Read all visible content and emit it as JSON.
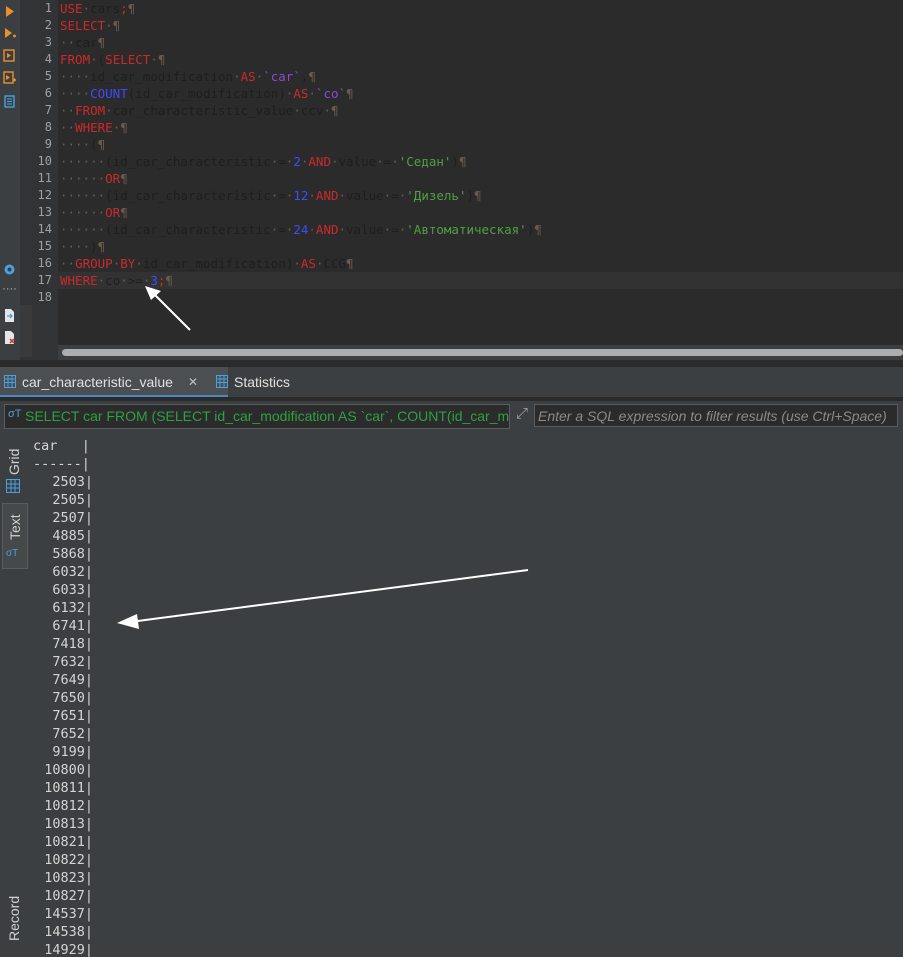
{
  "editor": {
    "line_numbers": [
      "1",
      "2",
      "3",
      "4",
      "5",
      "6",
      "7",
      "8",
      "9",
      "10",
      "11",
      "12",
      "13",
      "14",
      "15",
      "16",
      "17",
      "18"
    ],
    "lines": [
      [
        {
          "t": "USE",
          "c": "kw"
        },
        {
          "t": "·",
          "c": "ws"
        },
        {
          "t": "cars",
          "c": "id"
        },
        {
          "t": ";",
          "c": "kw"
        },
        {
          "t": "¶",
          "c": "pil"
        }
      ],
      [
        {
          "t": "SELECT",
          "c": "kw"
        },
        {
          "t": "·¶",
          "c": "ws"
        }
      ],
      [
        {
          "t": "··",
          "c": "ws"
        },
        {
          "t": "car",
          "c": "id"
        },
        {
          "t": "¶",
          "c": "pil"
        }
      ],
      [
        {
          "t": "FROM",
          "c": "kw"
        },
        {
          "t": "·",
          "c": "ws"
        },
        {
          "t": "(",
          "c": "id"
        },
        {
          "t": "SELECT",
          "c": "kw"
        },
        {
          "t": "·¶",
          "c": "ws"
        }
      ],
      [
        {
          "t": "····",
          "c": "ws"
        },
        {
          "t": "id_car_modification",
          "c": "id"
        },
        {
          "t": "·",
          "c": "ws"
        },
        {
          "t": "AS",
          "c": "kw"
        },
        {
          "t": "·",
          "c": "ws"
        },
        {
          "t": "`car`",
          "c": "bq"
        },
        {
          "t": ",",
          "c": "id"
        },
        {
          "t": "¶",
          "c": "pil"
        }
      ],
      [
        {
          "t": "····",
          "c": "ws"
        },
        {
          "t": "COUNT",
          "c": "fn"
        },
        {
          "t": "(id_car_modification)",
          "c": "id"
        },
        {
          "t": "·",
          "c": "ws"
        },
        {
          "t": "AS",
          "c": "kw"
        },
        {
          "t": "·",
          "c": "ws"
        },
        {
          "t": "`co`",
          "c": "bq"
        },
        {
          "t": "¶",
          "c": "pil"
        }
      ],
      [
        {
          "t": "··",
          "c": "ws"
        },
        {
          "t": "FROM",
          "c": "kw"
        },
        {
          "t": "·",
          "c": "ws"
        },
        {
          "t": "car_characteristic_value",
          "c": "id"
        },
        {
          "t": "·",
          "c": "ws"
        },
        {
          "t": "ccv",
          "c": "id"
        },
        {
          "t": "·¶",
          "c": "ws"
        }
      ],
      [
        {
          "t": "··",
          "c": "ws"
        },
        {
          "t": "WHERE",
          "c": "kw"
        },
        {
          "t": "·¶",
          "c": "ws"
        }
      ],
      [
        {
          "t": "····",
          "c": "ws"
        },
        {
          "t": "(",
          "c": "id"
        },
        {
          "t": "¶",
          "c": "pil"
        }
      ],
      [
        {
          "t": "······",
          "c": "ws"
        },
        {
          "t": "(id_car_characteristic",
          "c": "id"
        },
        {
          "t": "·",
          "c": "ws"
        },
        {
          "t": "=",
          "c": "id"
        },
        {
          "t": "·",
          "c": "ws"
        },
        {
          "t": "2",
          "c": "num"
        },
        {
          "t": "·",
          "c": "ws"
        },
        {
          "t": "AND",
          "c": "kw"
        },
        {
          "t": "·",
          "c": "ws"
        },
        {
          "t": "value",
          "c": "id"
        },
        {
          "t": "·",
          "c": "ws"
        },
        {
          "t": "=",
          "c": "id"
        },
        {
          "t": "·",
          "c": "ws"
        },
        {
          "t": "'Седан'",
          "c": "str"
        },
        {
          "t": ")",
          "c": "id"
        },
        {
          "t": "¶",
          "c": "pil"
        }
      ],
      [
        {
          "t": "······",
          "c": "ws"
        },
        {
          "t": "OR",
          "c": "kw"
        },
        {
          "t": "¶",
          "c": "pil"
        }
      ],
      [
        {
          "t": "······",
          "c": "ws"
        },
        {
          "t": "(id_car_characteristic",
          "c": "id"
        },
        {
          "t": "·",
          "c": "ws"
        },
        {
          "t": "=",
          "c": "id"
        },
        {
          "t": "·",
          "c": "ws"
        },
        {
          "t": "12",
          "c": "num"
        },
        {
          "t": "·",
          "c": "ws"
        },
        {
          "t": "AND",
          "c": "kw"
        },
        {
          "t": "·",
          "c": "ws"
        },
        {
          "t": "value",
          "c": "id"
        },
        {
          "t": "·",
          "c": "ws"
        },
        {
          "t": "=",
          "c": "id"
        },
        {
          "t": "·",
          "c": "ws"
        },
        {
          "t": "'Дизель'",
          "c": "str"
        },
        {
          "t": ")",
          "c": "id"
        },
        {
          "t": "¶",
          "c": "pil"
        }
      ],
      [
        {
          "t": "······",
          "c": "ws"
        },
        {
          "t": "OR",
          "c": "kw"
        },
        {
          "t": "¶",
          "c": "pil"
        }
      ],
      [
        {
          "t": "······",
          "c": "ws"
        },
        {
          "t": "(id_car_characteristic",
          "c": "id"
        },
        {
          "t": "·",
          "c": "ws"
        },
        {
          "t": "=",
          "c": "id"
        },
        {
          "t": "·",
          "c": "ws"
        },
        {
          "t": "24",
          "c": "num"
        },
        {
          "t": "·",
          "c": "ws"
        },
        {
          "t": "AND",
          "c": "kw"
        },
        {
          "t": "·",
          "c": "ws"
        },
        {
          "t": "value",
          "c": "id"
        },
        {
          "t": "·",
          "c": "ws"
        },
        {
          "t": "=",
          "c": "id"
        },
        {
          "t": "·",
          "c": "ws"
        },
        {
          "t": "'Автоматическая'",
          "c": "str"
        },
        {
          "t": ")",
          "c": "id"
        },
        {
          "t": "¶",
          "c": "pil"
        }
      ],
      [
        {
          "t": "····",
          "c": "ws"
        },
        {
          "t": ")",
          "c": "id"
        },
        {
          "t": "¶",
          "c": "pil"
        }
      ],
      [
        {
          "t": "··",
          "c": "ws"
        },
        {
          "t": "GROUP",
          "c": "kw"
        },
        {
          "t": "·",
          "c": "ws"
        },
        {
          "t": "BY",
          "c": "kw"
        },
        {
          "t": "·",
          "c": "ws"
        },
        {
          "t": "id_car_modification)",
          "c": "id"
        },
        {
          "t": "·",
          "c": "ws"
        },
        {
          "t": "AS",
          "c": "kw"
        },
        {
          "t": "·",
          "c": "ws"
        },
        {
          "t": "CCG",
          "c": "id"
        },
        {
          "t": "¶",
          "c": "pil"
        }
      ],
      [
        {
          "t": "WHERE",
          "c": "kw"
        },
        {
          "t": "·",
          "c": "ws"
        },
        {
          "t": "co",
          "c": "id"
        },
        {
          "t": "·",
          "c": "ws"
        },
        {
          "t": ">=",
          "c": "id"
        },
        {
          "t": "·",
          "c": "ws"
        },
        {
          "t": "3",
          "c": "num"
        },
        {
          "t": ";",
          "c": "kw"
        },
        {
          "t": "¶",
          "c": "pil"
        }
      ],
      []
    ],
    "current_line": 17
  },
  "tabs": [
    {
      "label": "car_characteristic_value",
      "active": true
    },
    {
      "label": "Statistics",
      "active": false
    }
  ],
  "filter": {
    "prefix": "σT",
    "sql": "SELECT car FROM (SELECT id_car_modification AS `car`, COUNT(id_car_m",
    "placeholder": "Enter a SQL expression to filter results (use Ctrl+Space)"
  },
  "side_tabs": {
    "grid": "Grid",
    "text": "Text",
    "record": "Record"
  },
  "result": {
    "header": "car   |",
    "separator": "------|",
    "rows": [
      "2503|",
      "2505|",
      "2507|",
      "4885|",
      "5868|",
      "6032|",
      "6033|",
      "6132|",
      "6741|",
      "7418|",
      "7632|",
      "7649|",
      "7650|",
      "7651|",
      "7652|",
      "9199|",
      "10800|",
      "10811|",
      "10812|",
      "10813|",
      "10821|",
      "10822|",
      "10823|",
      "10827|",
      "14537|",
      "14538|",
      "14929|"
    ]
  },
  "colors": {
    "accent": "#4a88c7",
    "keyword": "#cc2a2a",
    "string": "#4ea042",
    "number": "#3d4cff"
  }
}
